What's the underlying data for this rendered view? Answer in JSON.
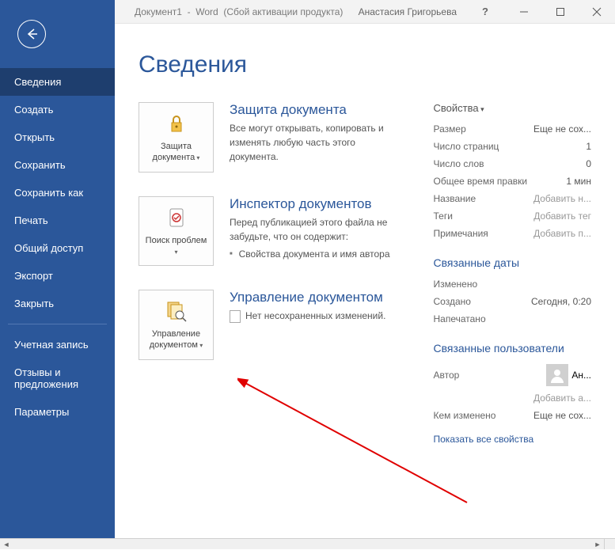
{
  "titlebar": {
    "document": "Документ1",
    "app": "Word",
    "status": "(Сбой активации продукта)",
    "user": "Анастасия Григорьева",
    "help": "?"
  },
  "sidebar": {
    "items": [
      "Сведения",
      "Создать",
      "Открыть",
      "Сохранить",
      "Сохранить как",
      "Печать",
      "Общий доступ",
      "Экспорт",
      "Закрыть"
    ],
    "bottom_items": [
      "Учетная запись",
      "Отзывы и предложения",
      "Параметры"
    ]
  },
  "page": {
    "heading": "Сведения",
    "sections": [
      {
        "button": "Защита документа",
        "title": "Защита документа",
        "desc": "Все могут открывать, копировать и изменять любую часть этого документа."
      },
      {
        "button": "Поиск проблем",
        "title": "Инспектор документов",
        "desc": "Перед публикацией этого файла не забудьте, что он содержит:",
        "bullet": "Свойства документа и имя автора"
      },
      {
        "button": "Управление документом",
        "title": "Управление документом",
        "desc": "Нет несохраненных изменений."
      }
    ]
  },
  "properties": {
    "heading": "Свойства",
    "rows": [
      {
        "label": "Размер",
        "value": "Еще не сох..."
      },
      {
        "label": "Число страниц",
        "value": "1"
      },
      {
        "label": "Число слов",
        "value": "0"
      },
      {
        "label": "Общее время правки",
        "value": "1 мин"
      },
      {
        "label": "Название",
        "placeholder": "Добавить н..."
      },
      {
        "label": "Теги",
        "placeholder": "Добавить тег"
      },
      {
        "label": "Примечания",
        "placeholder": "Добавить п..."
      }
    ],
    "dates_heading": "Связанные даты",
    "dates": [
      {
        "label": "Изменено",
        "value": ""
      },
      {
        "label": "Создано",
        "value": "Сегодня, 0:20"
      },
      {
        "label": "Напечатано",
        "value": ""
      }
    ],
    "people_heading": "Связанные пользователи",
    "author_label": "Автор",
    "author_name": "Ан...",
    "add_author": "Добавить а...",
    "modified_by_label": "Кем изменено",
    "modified_by_value": "Еще не сох...",
    "show_all": "Показать все свойства"
  }
}
